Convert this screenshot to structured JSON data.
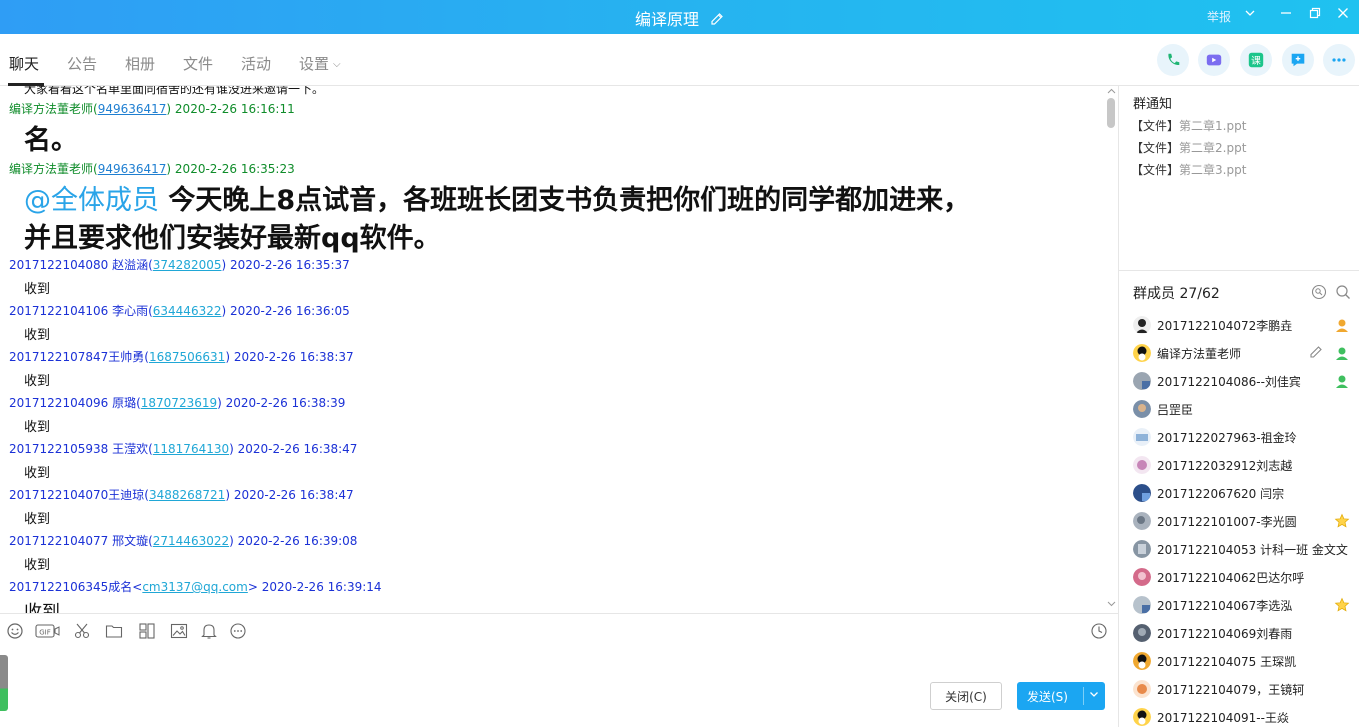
{
  "window": {
    "title": "编译原理",
    "report_label": "举报"
  },
  "tabs": [
    {
      "label": "聊天",
      "active": true
    },
    {
      "label": "公告"
    },
    {
      "label": "相册"
    },
    {
      "label": "文件"
    },
    {
      "label": "活动"
    },
    {
      "label": "设置"
    }
  ],
  "top_actions": [
    "phone-call-icon",
    "video-call-icon",
    "classroom-icon",
    "share-screen-icon",
    "more-icon"
  ],
  "chat": {
    "cutoff_text": "大家看看这个名单里面同宿舍的还有谁没进来邀请一下。",
    "messages": [
      {
        "name": "编译方法董老师",
        "qq": "949636417",
        "time": "2020-2-26 16:16:11",
        "style": "teacher"
      },
      {
        "name": "编译方法董老师",
        "qq": "949636417",
        "time": "2020-2-26 16:35:23",
        "style": "teacher"
      },
      {
        "name": "2017122104080 赵溢涵",
        "qq": "374282005",
        "time": "2020-2-26 16:35:37",
        "text": "收到"
      },
      {
        "name": "2017122104106 李心雨",
        "qq": "634446322",
        "time": "2020-2-26 16:36:05",
        "text": "收到"
      },
      {
        "name": "2017122107847王帅勇",
        "qq": "1687506631",
        "time": "2020-2-26 16:38:37",
        "text": "收到"
      },
      {
        "name": "2017122104096  原璐",
        "qq": "1870723619",
        "time": "2020-2-26 16:38:39",
        "text": "收到"
      },
      {
        "name": "2017122105938  王滢欢",
        "qq": "1181764130",
        "time": "2020-2-26 16:38:47",
        "text": "收到"
      },
      {
        "name": "2017122104070王迪琼",
        "qq": "3488268721",
        "time": "2020-2-26 16:38:47",
        "text": "收到"
      },
      {
        "name": "2017122104077 邢文璇",
        "qq": "2714463022",
        "time": "2020-2-26 16:39:08",
        "text": "收到"
      },
      {
        "name": "2017122106345成名",
        "email": "cm3137@qq.com",
        "time": "2020-2-26 16:39:14",
        "text": "收到"
      }
    ],
    "teacher_msg1": "名。",
    "teacher_msg2_at": "@全体成员",
    "teacher_msg2_line1": " 今天晚上8点试音，各班班长团支书负责把你们班的同学都加进来，",
    "teacher_msg2_line2": "并且要求他们安装好最新qq软件。"
  },
  "toolbar": [
    "emoji-icon",
    "gif-icon",
    "scissors-icon",
    "folder-icon",
    "screenshot-icon",
    "image-icon",
    "bell-icon",
    "more-dots-icon",
    "history-clock-icon"
  ],
  "buttons": {
    "close": "关闭(C)",
    "send": "发送(S)"
  },
  "group_notice": {
    "title": "群通知",
    "files": [
      {
        "prefix": "【文件】",
        "name": "第二章1.ppt"
      },
      {
        "prefix": "【文件】",
        "name": "第二章2.ppt"
      },
      {
        "prefix": "【文件】",
        "name": "第二章3.ppt"
      }
    ]
  },
  "members": {
    "title": "群成员 27/62",
    "list": [
      {
        "name": "2017122104072李鹏垚",
        "badge": "admin"
      },
      {
        "name": "编译方法董老师",
        "badge": "admin",
        "edit": true
      },
      {
        "name": "2017122104086--刘佳宾",
        "badge": "admin"
      },
      {
        "name": "吕罡臣"
      },
      {
        "name": "2017122027963-祖金玲"
      },
      {
        "name": "2017122032912刘志越"
      },
      {
        "name": "2017122067620 闫宗"
      },
      {
        "name": "2017122101007-李光圆",
        "badge": "star"
      },
      {
        "name": "2017122104053 计科一班 金文文"
      },
      {
        "name": "2017122104062巴达尔呼"
      },
      {
        "name": "2017122104067李选泓",
        "badge": "star"
      },
      {
        "name": "2017122104069刘春雨"
      },
      {
        "name": "2017122104075  王琛凯"
      },
      {
        "name": "2017122104079，王镜轲"
      },
      {
        "name": "2017122104091--王焱"
      }
    ]
  },
  "colors": {
    "title_bar": "#26b3f0",
    "sender_teacher": "#0f8c2a",
    "sender_student": "#1b31d6",
    "send_button": "#1ba6f2"
  }
}
